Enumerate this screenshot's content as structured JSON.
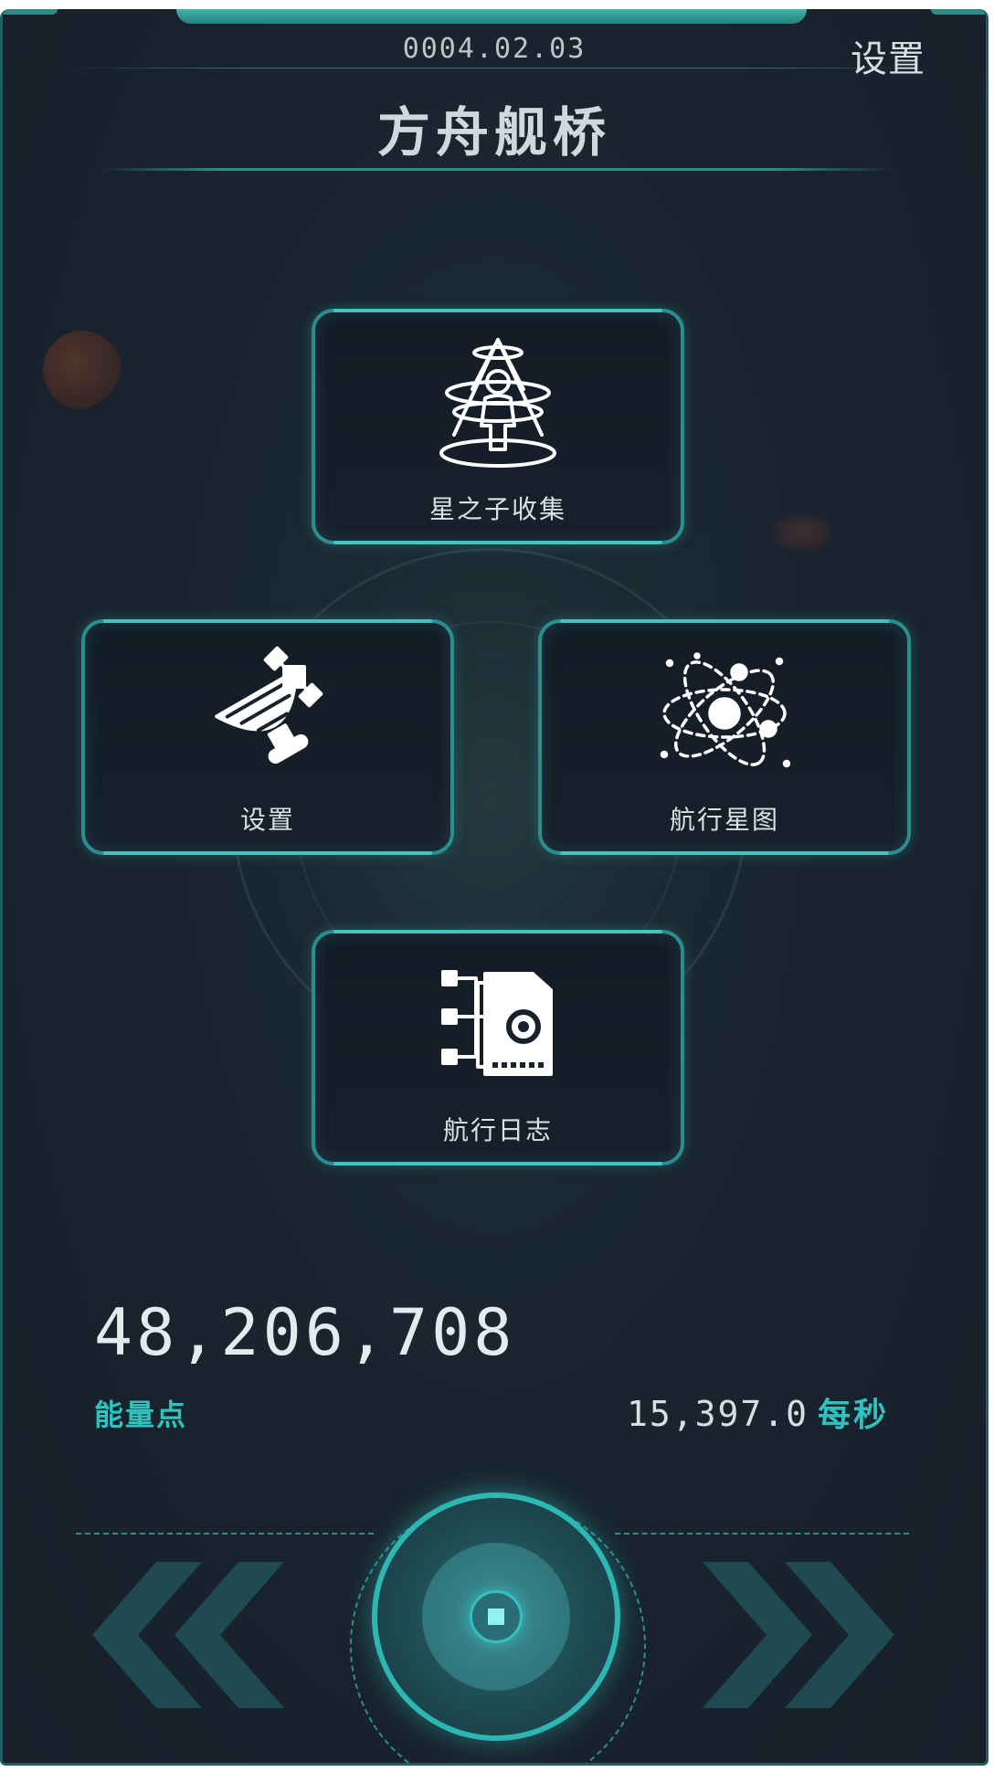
{
  "header": {
    "date": "0004.02.03",
    "settings_link": "设置",
    "title": "方舟舰桥"
  },
  "menu": {
    "collect": {
      "label": "星之子收集",
      "icon": "hologram-person-icon"
    },
    "settings": {
      "label": "设置",
      "icon": "satellite-dish-icon"
    },
    "starmap": {
      "label": "航行星图",
      "icon": "atom-orbit-icon"
    },
    "log": {
      "label": "航行日志",
      "icon": "document-gear-icon"
    }
  },
  "stats": {
    "energy_value": "48,206,708",
    "energy_label": "能量点",
    "rate_value": "15,397.0",
    "rate_unit": "每秒"
  },
  "nav": {
    "prev_icon": "double-chevron-left-icon",
    "next_icon": "double-chevron-right-icon",
    "center_icon": "center-action-icon"
  },
  "colors": {
    "accent": "#2fc3c0",
    "border": "#2b8d8f",
    "background": "#172029"
  }
}
